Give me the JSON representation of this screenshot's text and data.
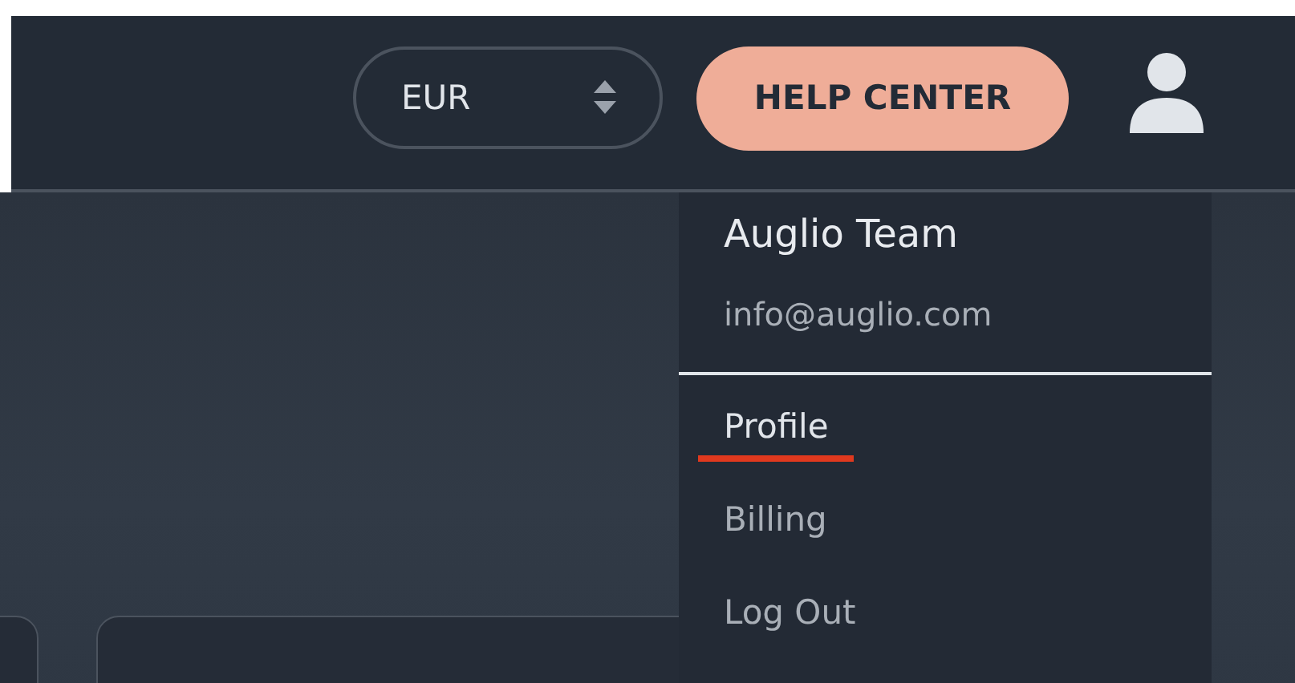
{
  "header": {
    "currency": {
      "value": "EUR"
    },
    "help_button": {
      "label": "HELP CENTER"
    }
  },
  "user_menu": {
    "name": "Auglio Team",
    "email": "info@auglio.com",
    "items": [
      {
        "label": "Profile",
        "selected": true
      },
      {
        "label": "Billing",
        "selected": false
      },
      {
        "label": "Log Out",
        "selected": false
      }
    ]
  }
}
